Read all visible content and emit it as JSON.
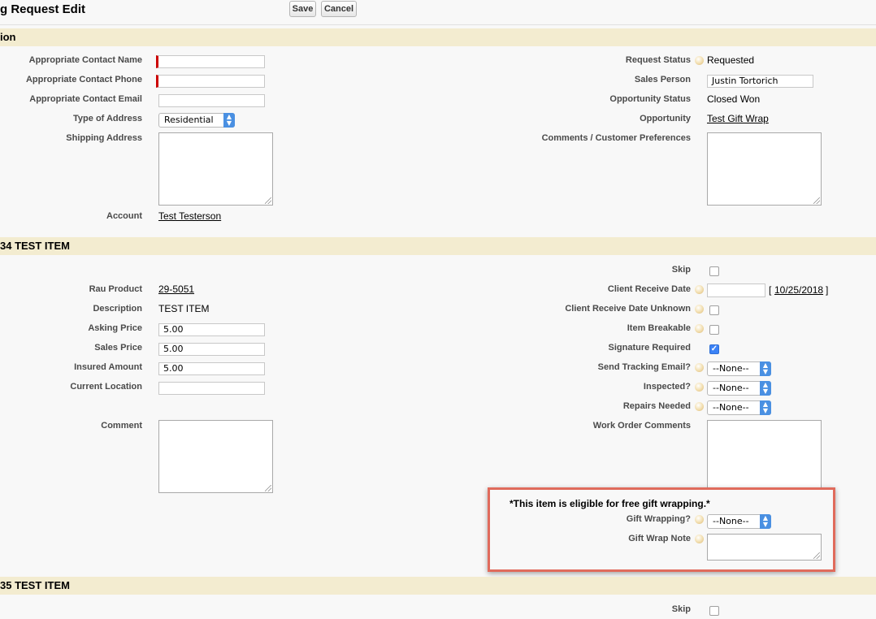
{
  "header": {
    "title": "g Request Edit",
    "save_label": "Save",
    "cancel_label": "Cancel"
  },
  "section1": {
    "title": "ion",
    "left": {
      "contact_name_label": "Appropriate Contact Name",
      "contact_phone_label": "Appropriate Contact Phone",
      "contact_email_label": "Appropriate Contact Email",
      "address_type_label": "Type of Address",
      "address_type_value": "Residential",
      "shipping_address_label": "Shipping Address",
      "account_label": "Account",
      "account_value": "Test Testerson"
    },
    "right": {
      "request_status_label": "Request Status",
      "request_status_value": "Requested",
      "sales_person_label": "Sales Person",
      "sales_person_value": "Justin Tortorich",
      "opportunity_status_label": "Opportunity Status",
      "opportunity_status_value": "Closed Won",
      "opportunity_label": "Opportunity",
      "opportunity_value": "Test Gift Wrap",
      "comments_label": "Comments / Customer Preferences"
    }
  },
  "section2": {
    "title": "34 TEST ITEM",
    "left": {
      "product_label": "Rau Product",
      "product_value": "29-5051",
      "description_label": "Description",
      "description_value": "TEST ITEM",
      "asking_price_label": "Asking Price",
      "asking_price_value": "5.00",
      "sales_price_label": "Sales Price",
      "sales_price_value": "5.00",
      "insured_amount_label": "Insured Amount",
      "insured_amount_value": "5.00",
      "current_location_label": "Current Location",
      "comment_label": "Comment"
    },
    "right": {
      "skip_label": "Skip",
      "client_receive_date_label": "Client Receive Date",
      "client_receive_date_link": "10/25/2018",
      "bracket_open": "[",
      "bracket_close": "]",
      "client_receive_unknown_label": "Client Receive Date Unknown",
      "item_breakable_label": "Item Breakable",
      "signature_required_label": "Signature Required",
      "send_tracking_label": "Send Tracking Email?",
      "send_tracking_value": "--None--",
      "inspected_label": "Inspected?",
      "inspected_value": "--None--",
      "repairs_label": "Repairs Needed",
      "repairs_value": "--None--",
      "work_order_label": "Work Order Comments"
    },
    "gift": {
      "notice": "*This item is eligible for free gift wrapping.*",
      "wrapping_label": "Gift Wrapping?",
      "wrapping_value": "--None--",
      "note_label": "Gift Wrap Note"
    }
  },
  "section3": {
    "title": "35 TEST ITEM",
    "skip_label": "Skip"
  },
  "icons": {
    "help": "help-bubble-icon",
    "check": "checkmark-icon",
    "select": "select-arrows-icon"
  },
  "colors": {
    "section_bg": "#f3ecd0",
    "required": "#cc0000",
    "highlight_box": "#e06b5c",
    "checkbox_checked": "#3b82f6",
    "select_arrow": "#4a90e2"
  }
}
